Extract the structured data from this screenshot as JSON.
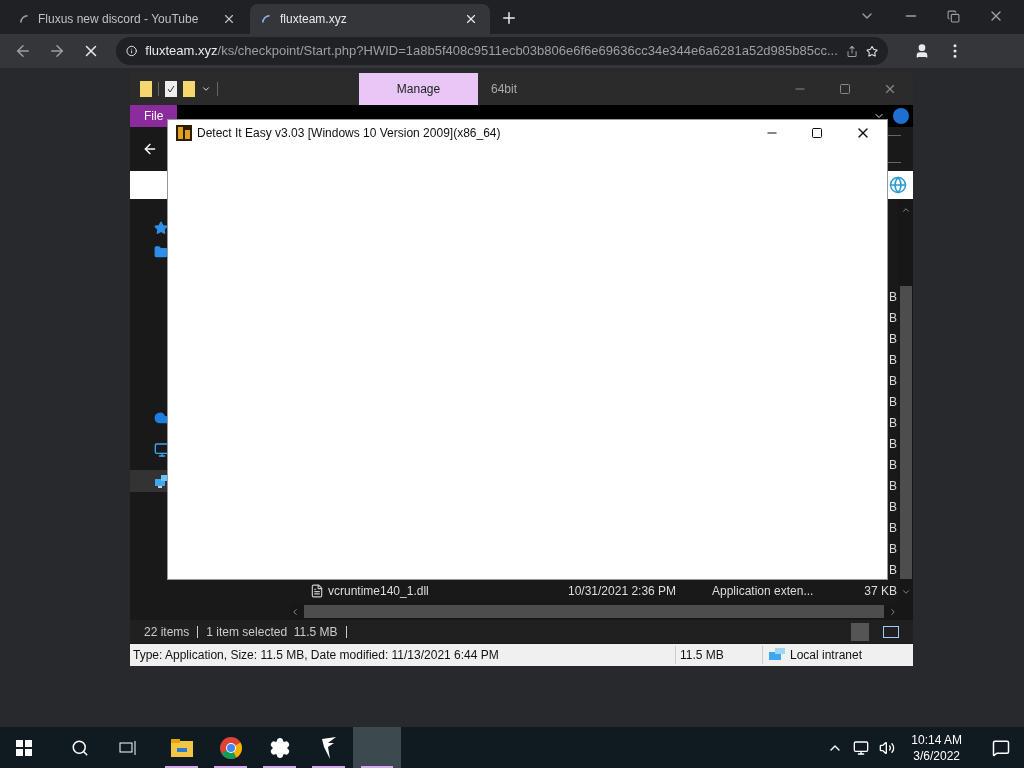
{
  "browser": {
    "tabs": [
      {
        "title": "Fluxus new discord - YouTube",
        "selected": false,
        "loading": true
      },
      {
        "title": "fluxteam.xyz",
        "selected": true,
        "loading": true
      }
    ],
    "address": {
      "host": "fluxteam.xyz",
      "path": "/ks/checkpoint/Start.php?HWID=1a8b5f408c9511ecb03b806e6f6e69636cc34e344e6a6281a52d985b85cc..."
    }
  },
  "explorer": {
    "context_tab": "Manage",
    "title": "64bit",
    "ribbon_tabs": [
      {
        "label": "File",
        "selected": true
      }
    ],
    "nav_items": [
      {
        "kind": "star",
        "selected": false
      },
      {
        "kind": "folder",
        "selected": false
      },
      {
        "kind": "cloud",
        "selected": false
      },
      {
        "kind": "monitor",
        "selected": false
      },
      {
        "kind": "network",
        "selected": true
      }
    ],
    "rows": [
      {
        "size": "B"
      },
      {
        "size": "B"
      },
      {
        "size": "B"
      },
      {
        "size": "B"
      },
      {
        "size": "B"
      },
      {
        "size": "B"
      },
      {
        "size": "B"
      },
      {
        "size": "B"
      },
      {
        "size": "B"
      },
      {
        "size": "B"
      },
      {
        "size": "B"
      },
      {
        "size": "B"
      },
      {
        "size": "B"
      },
      {
        "size": "B"
      },
      {
        "name": "vcruntime140_1.dll",
        "date": "10/31/2021 2:36 PM",
        "type": "Application exten...",
        "size": "37 KB"
      }
    ],
    "status": {
      "items": "22 items",
      "selection": "1 item selected  11.5 MB"
    },
    "details": {
      "text": "Type: Application, Size: 11.5 MB, Date modified: 11/13/2021 6:44 PM",
      "size": "11.5 MB",
      "zone": "Local intranet"
    }
  },
  "dialog": {
    "title": "Detect It Easy v3.03 [Windows 10 Version 2009](x86_64)"
  },
  "taskbar": {
    "apps": [
      {
        "kind": "explorer",
        "running": true
      },
      {
        "kind": "chrome",
        "running": true
      },
      {
        "kind": "settings",
        "running": true
      },
      {
        "kind": "fluxus",
        "running": true
      },
      {
        "kind": "blank",
        "running": true,
        "selected": true
      }
    ],
    "time": "10:14 AM",
    "date": "3/6/2022"
  }
}
